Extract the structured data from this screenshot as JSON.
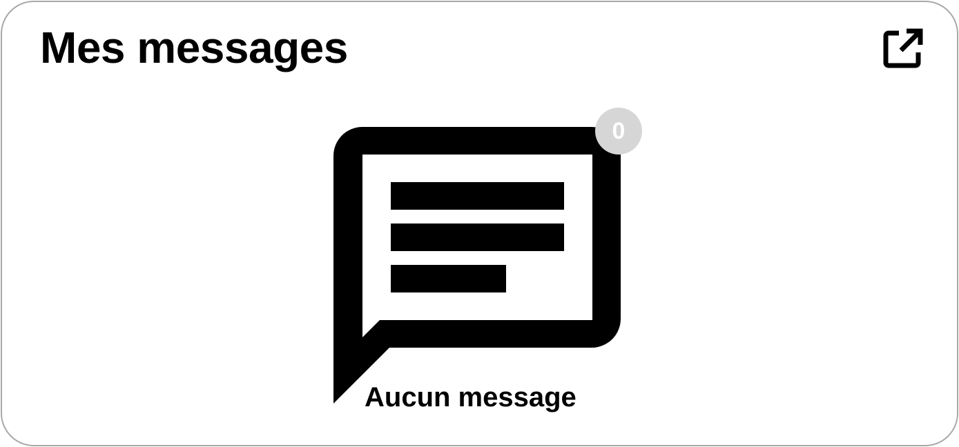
{
  "widget": {
    "title": "Mes messages",
    "message_count": "0",
    "empty_state_text": "Aucun message",
    "icons": {
      "open": "external-link-icon",
      "messages": "chat-bubble-icon"
    },
    "colors": {
      "text": "#000000",
      "border": "#a8a8a8",
      "badge_background": "#d6d6d6",
      "badge_text": "#ffffff"
    }
  }
}
